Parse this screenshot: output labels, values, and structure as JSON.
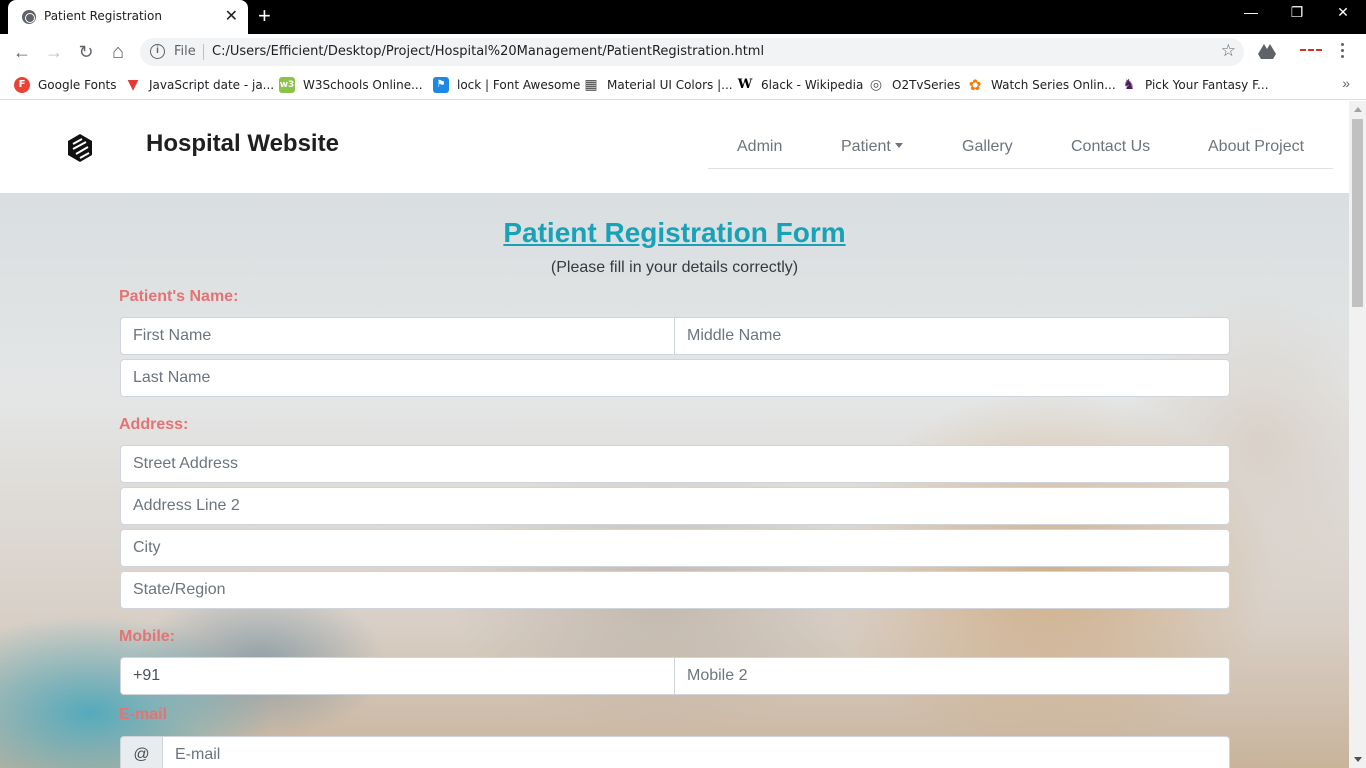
{
  "browser": {
    "tab_title": "Patient Registration",
    "tab_close": "✕",
    "new_tab": "+",
    "window_minimize": "—",
    "window_restore": "❐",
    "window_close": "✕",
    "back": "←",
    "forward": "→",
    "reload": "↻",
    "home": "⌂",
    "info": "i",
    "scheme": "File",
    "url": "C:/Users/Efficient/Desktop/Project/Hospital%20Management/PatientRegistration.html",
    "star": "☆",
    "more_bookmarks": "»"
  },
  "bookmarks": [
    {
      "label": "Google Fonts",
      "icon": "google-fonts-icon",
      "glyph": "F",
      "color": "#ea4335"
    },
    {
      "label": "JavaScript date - ja...",
      "icon": "triangle-icon",
      "glyph": "▼",
      "color": "#e53935"
    },
    {
      "label": "W3Schools Online...",
      "icon": "w3schools-icon",
      "glyph": "w3",
      "color": "#8bc34a"
    },
    {
      "label": "lock | Font Awesome",
      "icon": "flag-icon",
      "glyph": "⚑",
      "color": "#1e88e5"
    },
    {
      "label": "Material UI Colors |...",
      "icon": "material-icon",
      "glyph": "▦",
      "color": "#424242"
    },
    {
      "label": "6lack - Wikipedia",
      "icon": "wikipedia-icon",
      "glyph": "W",
      "color": "#ffffff"
    },
    {
      "label": "O2TvSeries",
      "icon": "o2tv-icon",
      "glyph": "◎",
      "color": "#555555"
    },
    {
      "label": "Watch Series Onlin...",
      "icon": "watchseries-icon",
      "glyph": "✿",
      "color": "#f57c00"
    },
    {
      "label": "Pick Your Fantasy F...",
      "icon": "fantasy-icon",
      "glyph": "♞",
      "color": "#4a1d5e"
    }
  ],
  "site": {
    "brand": "Hospital Website",
    "nav": [
      {
        "label": "Admin"
      },
      {
        "label": "Patient"
      },
      {
        "label": "Gallery"
      },
      {
        "label": "Contact Us"
      },
      {
        "label": "About Project"
      }
    ]
  },
  "form": {
    "title": "Patient Registration Form",
    "subtitle": "(Please fill in your details correctly)",
    "name_label": "Patient's Name:",
    "first_name_placeholder": "First Name",
    "middle_name_placeholder": "Middle Name",
    "last_name_placeholder": "Last Name",
    "address_label": "Address:",
    "street_placeholder": "Street Address",
    "address2_placeholder": "Address Line 2",
    "city_placeholder": "City",
    "state_placeholder": "State/Region",
    "mobile_label": "Mobile:",
    "mobile_value": "+91",
    "mobile2_placeholder": "Mobile 2",
    "email_label": "E-mail",
    "email_prefix": "@",
    "email_placeholder": "E-mail"
  },
  "colors": {
    "label": "#e57373",
    "title": "#17a2b8",
    "nav_text": "#6c757d"
  }
}
